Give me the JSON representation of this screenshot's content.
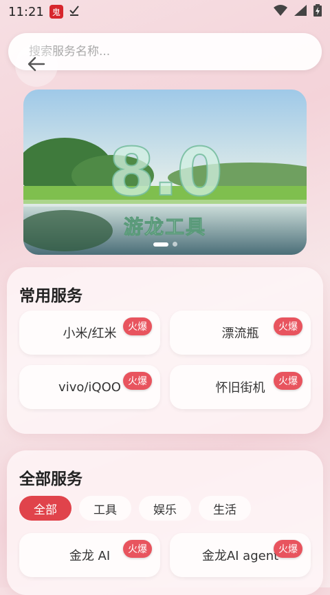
{
  "status_bar": {
    "time": "11:21",
    "app_badge": "鬼"
  },
  "search": {
    "placeholder": "搜索服务名称..."
  },
  "banner": {
    "title": "8.0",
    "subtitle": "游龙工具"
  },
  "common_services": {
    "title": "常用服务",
    "items": [
      {
        "label": "小米/红米",
        "badge": "火爆"
      },
      {
        "label": "漂流瓶",
        "badge": "火爆"
      },
      {
        "label": "vivo/iQOO",
        "badge": "火爆"
      },
      {
        "label": "怀旧街机",
        "badge": "火爆"
      }
    ]
  },
  "all_services": {
    "title": "全部服务",
    "tabs": [
      {
        "label": "全部",
        "active": true
      },
      {
        "label": "工具",
        "active": false
      },
      {
        "label": "娱乐",
        "active": false
      },
      {
        "label": "生活",
        "active": false
      }
    ],
    "items": [
      {
        "label": "金龙 AI",
        "badge": "火爆"
      },
      {
        "label": "金龙AI agent",
        "badge": "火爆"
      }
    ]
  },
  "colors": {
    "accent": "#e0434b",
    "badge": "#e8545e"
  }
}
